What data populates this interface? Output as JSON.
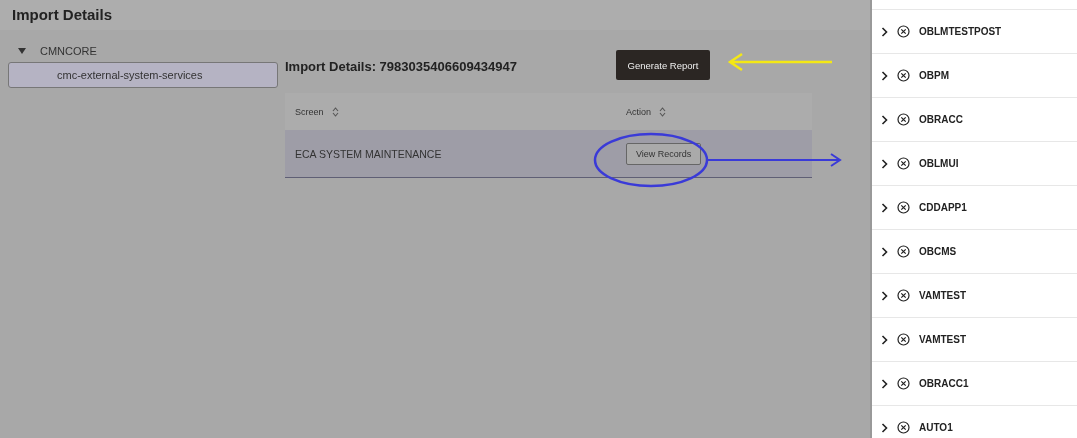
{
  "page_title": "Import Details",
  "tree": [
    {
      "label": "CMNCORE",
      "expanded": true,
      "children": [
        {
          "label": "cmc-external-system-services",
          "selected": true
        }
      ]
    }
  ],
  "details": {
    "title": "Import Details: 7983035406609434947",
    "generate_button": "Generate Report",
    "table": {
      "columns": [
        {
          "label": "Screen"
        },
        {
          "label": "Action"
        }
      ],
      "rows": [
        {
          "screen": "ECA SYSTEM MAINTENANCE",
          "action": "View Records"
        }
      ]
    }
  },
  "side_list": [
    {
      "label": "OBLMTESTPOST",
      "expanded": false
    },
    {
      "label": "OBPM",
      "expanded": false
    },
    {
      "label": "OBRACC",
      "expanded": false
    },
    {
      "label": "OBLMUI",
      "expanded": false
    },
    {
      "label": "CDDAPP1",
      "expanded": false
    },
    {
      "label": "OBCMS",
      "expanded": false
    },
    {
      "label": "VAMTEST",
      "expanded": false
    },
    {
      "label": "VAMTEST",
      "expanded": false
    },
    {
      "label": "OBRACC1",
      "expanded": false
    },
    {
      "label": "AUTO1",
      "expanded": false
    }
  ]
}
